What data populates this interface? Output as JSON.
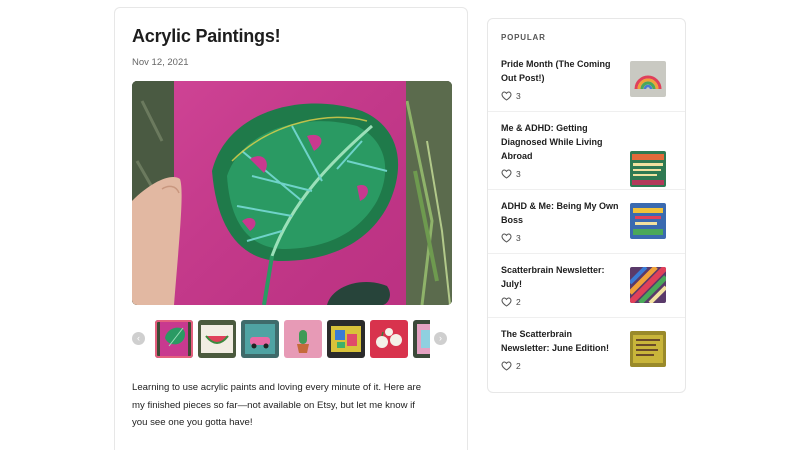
{
  "post": {
    "title": "Acrylic Paintings!",
    "date": "Nov 12, 2021",
    "hero_image": "monstera-leaf-painting",
    "body": "Learning to use acrylic paints and loving every minute of it. Here are my finished pieces so far—not available on Etsy, but let me know if you see one you gotta have!",
    "carousel": {
      "prev_icon": "chevron-left-icon",
      "next_icon": "chevron-right-icon",
      "thumbnails": [
        {
          "subject": "monstera-leaf-painting",
          "active": true
        },
        {
          "subject": "watermelon-painting",
          "active": false
        },
        {
          "subject": "pink-car-painting",
          "active": false
        },
        {
          "subject": "cactus-pot-painting",
          "active": false
        },
        {
          "subject": "colorful-abstract-painting",
          "active": false
        },
        {
          "subject": "apples-painting",
          "active": false
        },
        {
          "subject": "partial-painting",
          "active": false
        }
      ]
    }
  },
  "sidebar": {
    "heading": "POPULAR",
    "items": [
      {
        "title": "Pride Month (The Coming Out Post!)",
        "likes": "3",
        "thumb": "rainbow-art"
      },
      {
        "title": "Me & ADHD: Getting Diagnosed While Living Abroad",
        "likes": "3",
        "thumb": "adhd-text-art"
      },
      {
        "title": "ADHD & Me: Being My Own Boss",
        "likes": "3",
        "thumb": "boss-text-art"
      },
      {
        "title": "Scatterbrain Newsletter: July!",
        "likes": "2",
        "thumb": "stripes-art"
      },
      {
        "title": "The Scatterbrain Newsletter: June Edition!",
        "likes": "2",
        "thumb": "newsletter-art"
      }
    ]
  },
  "colors": {
    "active_thumb_border": "#e45f7f",
    "canvas_pink": "#c8398f",
    "leaf_green": "#1f7a4a"
  }
}
